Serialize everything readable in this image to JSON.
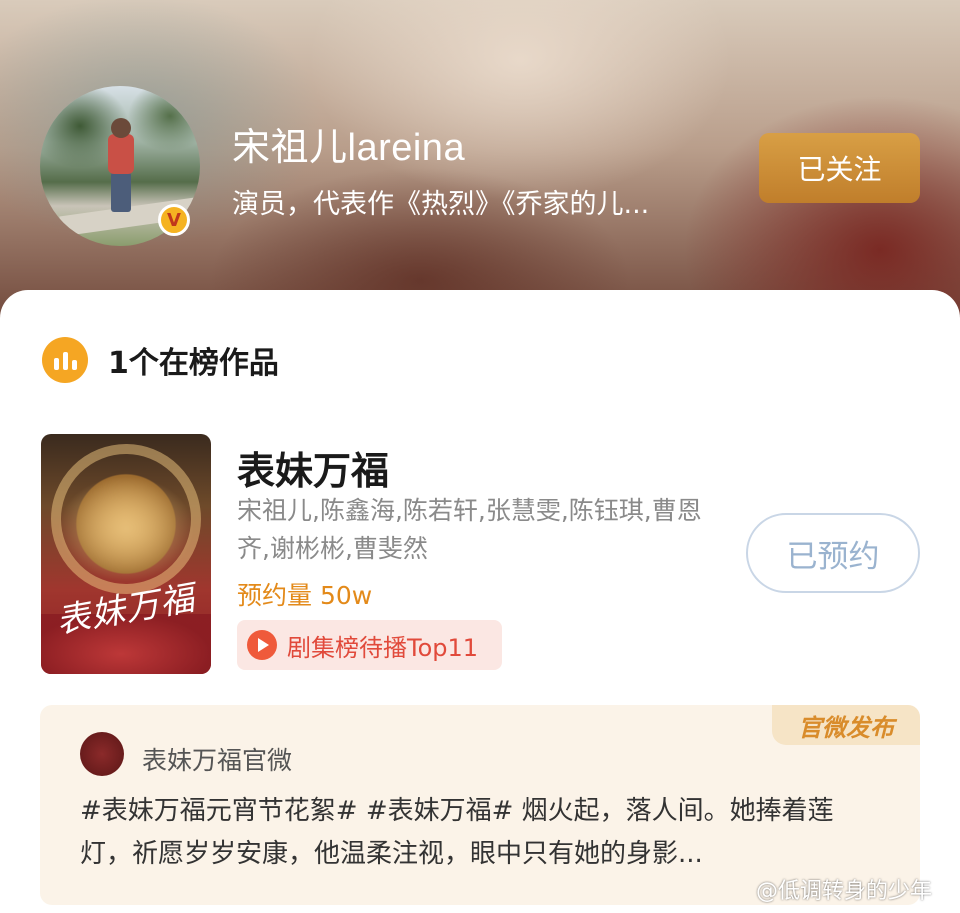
{
  "profile": {
    "username": "宋祖儿lareina",
    "bio": "演员，代表作《热烈》《乔家的儿...",
    "follow_label": "已关注",
    "verified_mark": "V"
  },
  "section": {
    "title": "1个在榜作品"
  },
  "work": {
    "title": "表妹万福",
    "cast": "宋祖儿,陈鑫海,陈若轩,张慧雯,陈钰琪,曹恩齐,谢彬彬,曹斐然",
    "reserve_text": "预约量 50w",
    "rank_badge": "剧集榜待播Top11",
    "reserve_button": "已预约",
    "poster_calligraphy": "表妹万福"
  },
  "official_post": {
    "tag": "官微发布",
    "author": "表妹万福官微",
    "text": "#表妹万福元宵节花絮# #表妹万福# 烟火起，落人间。她捧着莲灯，祈愿岁岁安康，他温柔注视，眼中只有她的身影..."
  },
  "watermark": {
    "text": "@低调转身的少年"
  },
  "colors": {
    "follow_btn": "#c98a35",
    "reserve_orange": "#e38a1a",
    "rank_red": "#e14a3b",
    "section_icon": "#f5a623"
  }
}
